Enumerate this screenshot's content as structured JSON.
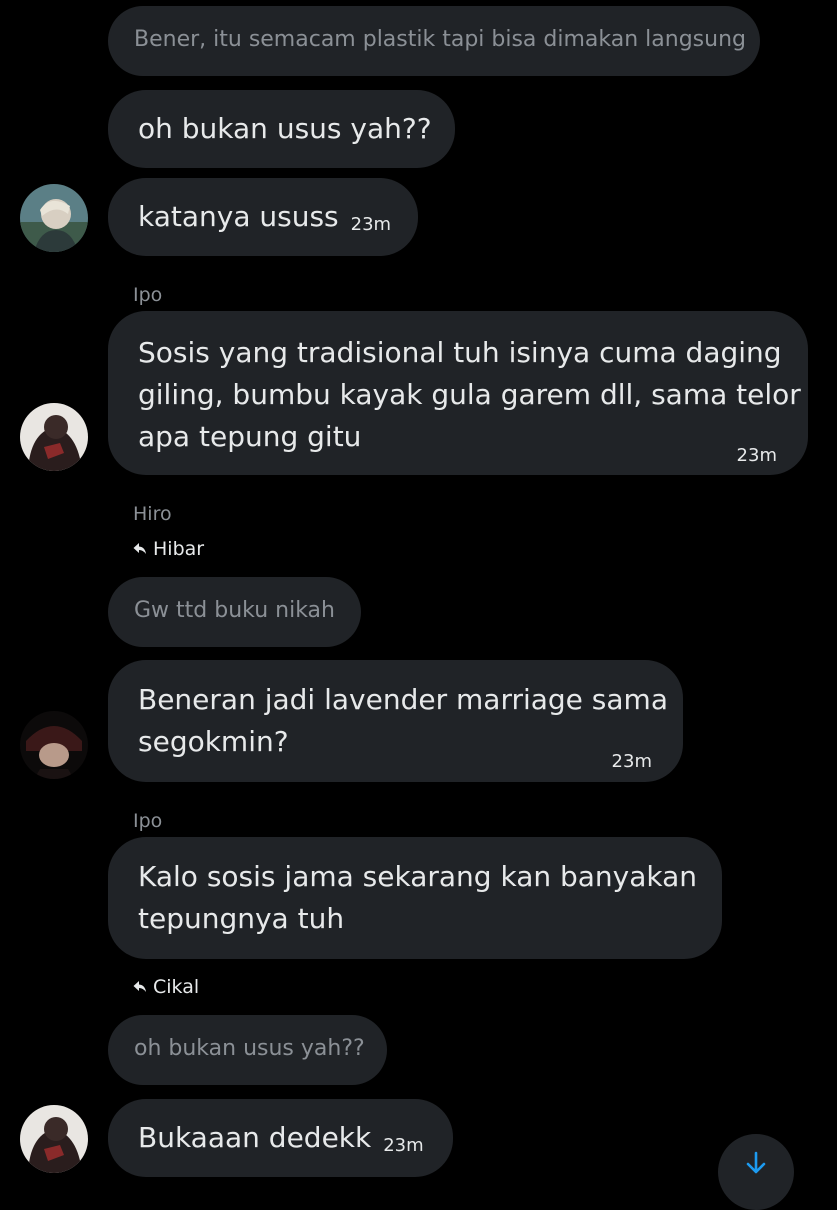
{
  "messages": [
    {
      "id": "m1",
      "kind": "quoted",
      "text": "Bener, itu semacam plastik tapi bisa dimakan langsung"
    },
    {
      "id": "m2",
      "kind": "message",
      "text": "oh bukan usus yah??"
    },
    {
      "id": "m3",
      "kind": "message",
      "text": "katanya ususs",
      "time": "23m"
    },
    {
      "id": "m4",
      "kind": "message",
      "sender": "Ipo",
      "lines": [
        "Sosis yang tradisional tuh isinya cuma daging",
        "giling, bumbu kayak gula garem dll, sama telor",
        "apa tepung gitu"
      ],
      "time": "23m"
    },
    {
      "id": "m5",
      "kind": "message",
      "sender": "Hiro",
      "reply_to": "Hibar",
      "quote": "Gw ttd buku nikah",
      "lines": [
        "Beneran jadi lavender marriage sama",
        "segokmin?"
      ],
      "time": "23m"
    },
    {
      "id": "m6",
      "kind": "message",
      "sender": "Ipo",
      "lines": [
        "Kalo sosis jama sekarang kan banyakan",
        "tepungnya tuh"
      ]
    },
    {
      "id": "m7",
      "kind": "message",
      "reply_to": "Cikal",
      "quote": "oh bukan usus yah??",
      "text": "Bukaaan dedekk",
      "time": "23m"
    }
  ],
  "icons": {
    "reply": "reply-arrow-icon",
    "scroll_down": "arrow-down-icon"
  },
  "colors": {
    "background": "#000000",
    "bubble": "#202327",
    "text": "#e7e9ea",
    "muted": "#8b9096",
    "accent": "#1d9bf0"
  }
}
